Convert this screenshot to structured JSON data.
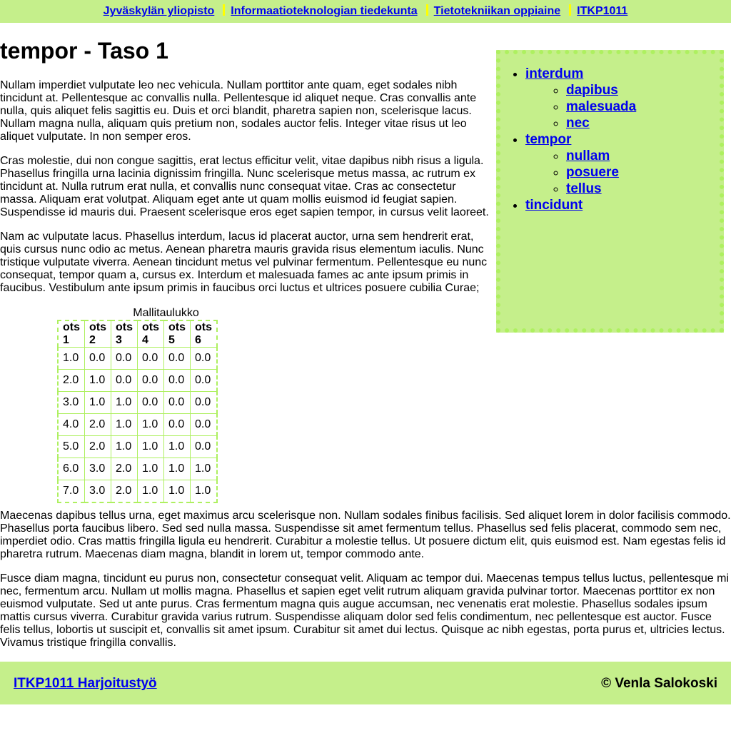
{
  "nav": {
    "links": [
      "Jyväskylän yliopisto",
      "Informaatioteknologian tiedekunta",
      "Tietotekniikan oppiaine",
      "ITKP1011"
    ]
  },
  "page_title": "tempor - Taso 1",
  "paragraphs": [
    "Nullam imperdiet vulputate leo nec vehicula. Nullam porttitor ante quam, eget sodales nibh tincidunt at. Pellentesque ac convallis nulla. Pellentesque id aliquet neque. Cras convallis ante nulla, quis aliquet felis sagittis eu. Duis et orci blandit, pharetra sapien non, scelerisque lacus. Nullam magna nulla, aliquam quis pretium non, sodales auctor felis. Integer vitae risus ut leo aliquet vulputate. In non semper eros.",
    "Cras molestie, dui non congue sagittis, erat lectus efficitur velit, vitae dapibus nibh risus a ligula. Phasellus fringilla urna lacinia dignissim fringilla. Nunc scelerisque metus massa, ac rutrum ex tincidunt at. Nulla rutrum erat nulla, et convallis nunc consequat vitae. Cras ac consectetur massa. Aliquam erat volutpat. Aliquam eget ante ut quam mollis euismod id feugiat sapien. Suspendisse id mauris dui. Praesent scelerisque eros eget sapien tempor, in cursus velit laoreet.",
    "Nam ac vulputate lacus. Phasellus interdum, lacus id placerat auctor, urna sem hendrerit erat, quis cursus nunc odio ac metus. Aenean pharetra mauris gravida risus elementum iaculis. Nunc tristique vulputate viverra. Aenean tincidunt metus vel pulvinar fermentum. Pellentesque eu nunc consequat, tempor quam a, cursus ex. Interdum et malesuada fames ac ante ipsum primis in faucibus. Vestibulum ante ipsum primis in faucibus orci luctus et ultrices posuere cubilia Curae;",
    "Maecenas dapibus tellus urna, eget maximus arcu scelerisque non. Nullam sodales finibus facilisis. Sed aliquet lorem in dolor facilisis commodo. Phasellus porta faucibus libero. Sed sed nulla massa. Suspendisse sit amet fermentum tellus. Phasellus sed felis placerat, commodo sem nec, imperdiet odio. Cras mattis fringilla ligula eu hendrerit. Curabitur a molestie tellus. Ut posuere dictum elit, quis euismod est. Nam egestas felis id pharetra rutrum. Maecenas diam magna, blandit in lorem ut, tempor commodo ante.",
    "Fusce diam magna, tincidunt eu purus non, consectetur consequat velit. Aliquam ac tempor dui. Maecenas tempus tellus luctus, pellentesque mi nec, fermentum arcu. Nullam ut mollis magna. Phasellus et sapien eget velit rutrum aliquam gravida pulvinar tortor. Maecenas porttitor ex non euismod vulputate. Sed ut ante purus. Cras fermentum magna quis augue accumsan, nec venenatis erat molestie. Phasellus sodales ipsum mattis cursus viverra. Curabitur gravida varius rutrum. Suspendisse aliquam dolor sed felis condimentum, nec pellentesque est auctor. Fusce felis tellus, lobortis ut suscipit et, convallis sit amet ipsum. Curabitur sit amet dui lectus. Quisque ac nibh egestas, porta purus et, ultricies lectus. Vivamus tristique fringilla convallis."
  ],
  "table": {
    "caption": "Mallitaulukko",
    "headers": [
      "ots 1",
      "ots 2",
      "ots 3",
      "ots 4",
      "ots 5",
      "ots 6"
    ],
    "rows": [
      [
        "1.0",
        "0.0",
        "0.0",
        "0.0",
        "0.0",
        "0.0"
      ],
      [
        "2.0",
        "1.0",
        "0.0",
        "0.0",
        "0.0",
        "0.0"
      ],
      [
        "3.0",
        "1.0",
        "1.0",
        "0.0",
        "0.0",
        "0.0"
      ],
      [
        "4.0",
        "2.0",
        "1.0",
        "1.0",
        "0.0",
        "0.0"
      ],
      [
        "5.0",
        "2.0",
        "1.0",
        "1.0",
        "1.0",
        "0.0"
      ],
      [
        "6.0",
        "3.0",
        "2.0",
        "1.0",
        "1.0",
        "1.0"
      ],
      [
        "7.0",
        "3.0",
        "2.0",
        "1.0",
        "1.0",
        "1.0"
      ]
    ]
  },
  "sidebar": {
    "items": [
      {
        "label": "interdum",
        "children": [
          "dapibus",
          "malesuada",
          "nec"
        ]
      },
      {
        "label": "tempor",
        "children": [
          "nullam",
          "posuere",
          "tellus"
        ]
      },
      {
        "label": "tincidunt",
        "children": []
      }
    ]
  },
  "footer": {
    "link": "ITKP1011 Harjoitustyö",
    "copyright": "©  Venla Salokoski"
  },
  "colors": {
    "header_bg": "#c5ef8b",
    "border_green": "#aef060",
    "nav_separator": "#ffff00",
    "link": "#0000ee"
  }
}
